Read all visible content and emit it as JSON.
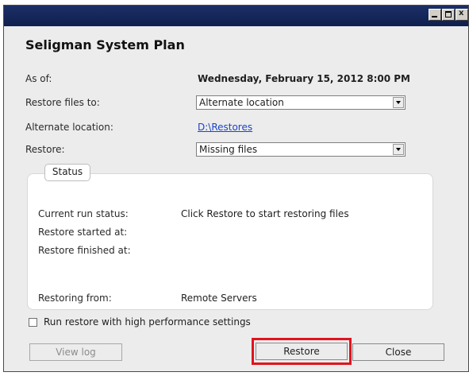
{
  "window": {
    "controls": {
      "minimize": "_",
      "maximize": "",
      "close": "x"
    }
  },
  "plan": {
    "title": "Seligman System Plan"
  },
  "fields": {
    "as_of": {
      "label": "As of:",
      "value": "Wednesday, February 15, 2012 8:00 PM"
    },
    "restore_files_to": {
      "label": "Restore files to:",
      "selected": "Alternate location"
    },
    "alternate_location": {
      "label": "Alternate location:",
      "value": "D:\\Restores"
    },
    "restore": {
      "label": "Restore:",
      "selected": "Missing files"
    }
  },
  "status": {
    "tab_label": "Status",
    "current_run_status": {
      "label": "Current run status:",
      "value": "Click Restore to start restoring files"
    },
    "restore_started_at": {
      "label": "Restore started at:",
      "value": ""
    },
    "restore_finished_at": {
      "label": "Restore finished at:",
      "value": ""
    },
    "restoring_from": {
      "label": "Restoring from:",
      "value": "Remote Servers"
    }
  },
  "options": {
    "high_performance": {
      "label": "Run restore with high performance settings",
      "checked": false
    }
  },
  "buttons": {
    "view_log": "View log",
    "restore": "Restore",
    "close": "Close"
  },
  "colors": {
    "titlebar": "#0f1f4f",
    "link": "#1a44c9",
    "highlight": "#e0141e"
  },
  "icons": [
    "minimize-icon",
    "maximize-icon",
    "close-icon",
    "chevron-down-icon",
    "checkbox-icon"
  ]
}
